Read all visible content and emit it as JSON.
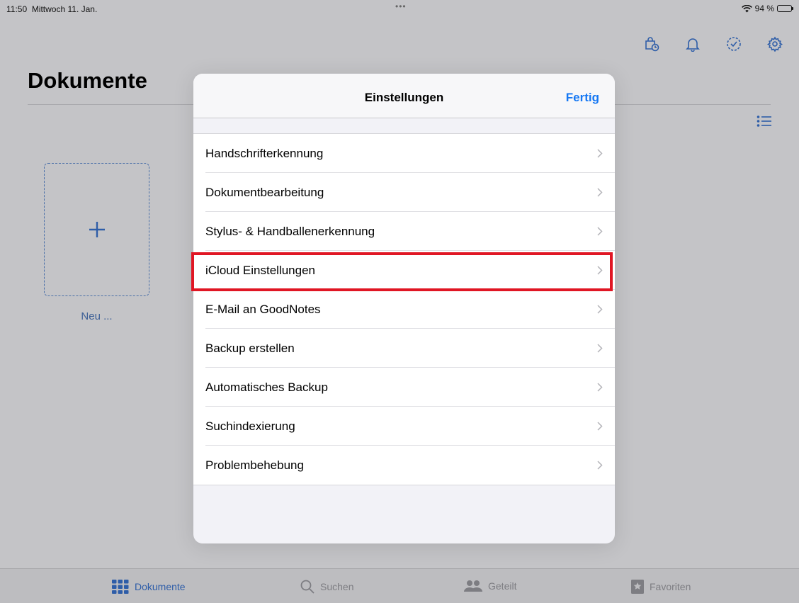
{
  "status_bar": {
    "time": "11:50",
    "date": "Mittwoch 11. Jan.",
    "dots": "•••",
    "battery": "94 %"
  },
  "page": {
    "title": "Dokumente",
    "new_label": "Neu ..."
  },
  "modal": {
    "title": "Einstellungen",
    "done_label": "Fertig",
    "items": [
      "Handschrifterkennung",
      "Dokumentbearbeitung",
      "Stylus- & Handballenerkennung",
      "iCloud Einstellungen",
      "E-Mail an GoodNotes",
      "Backup erstellen",
      "Automatisches Backup",
      "Suchindexierung",
      "Problembehebung"
    ]
  },
  "tabs": [
    {
      "label": "Dokumente",
      "icon": "grid-icon",
      "active": true
    },
    {
      "label": "Suchen",
      "icon": "search-icon",
      "active": false
    },
    {
      "label": "Geteilt",
      "icon": "people-icon",
      "active": false
    },
    {
      "label": "Favoriten",
      "icon": "star-bookmark-icon",
      "active": false
    }
  ],
  "colors": {
    "accent": "#1577f3",
    "highlight": "#e01624"
  }
}
